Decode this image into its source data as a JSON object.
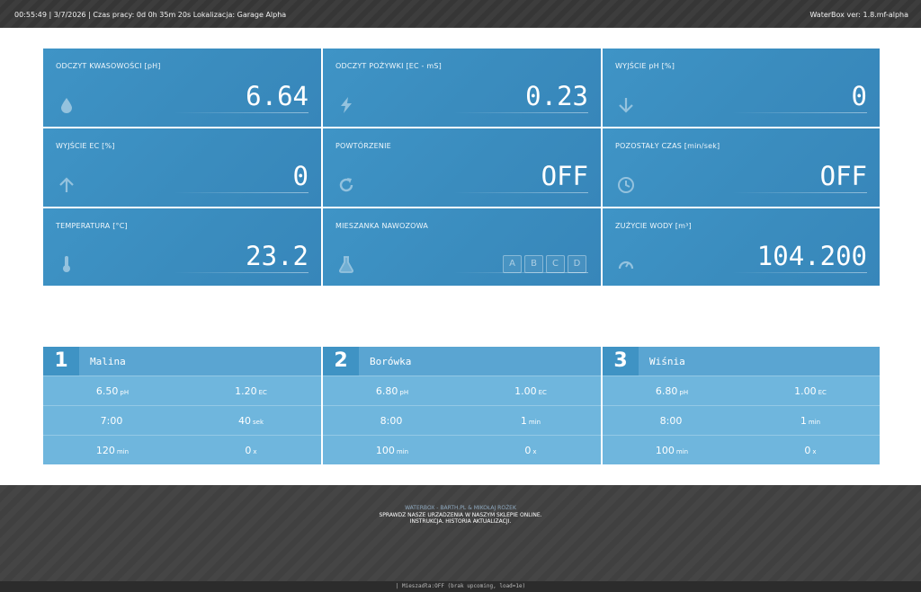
{
  "topbar": {
    "status_text": "00:55:49 | 3/7/2026 | Czas pracy: 0d 0h 35m 20s Lokalizacja: Garage Alpha",
    "version_text": "WaterBox ver: 1.8.mf-alpha"
  },
  "tiles": [
    {
      "label": "ODCZYT KWASOWOŚCI [pH]",
      "value": "6.64",
      "icon": "water-drop-icon"
    },
    {
      "label": "ODCZYT POŻYWKI [EC - mS]",
      "value": "0.23",
      "icon": "lightning-icon"
    },
    {
      "label": "WYJŚCIE pH [%]",
      "value": "0",
      "icon": "arrow-down-icon"
    },
    {
      "label": "WYJŚCIE EC [%]",
      "value": "0",
      "icon": "arrow-up-icon"
    },
    {
      "label": "POWTÓRZENIE",
      "value": "OFF",
      "icon": "refresh-icon"
    },
    {
      "label": "POZOSTAŁY CZAS [min/sek]",
      "value": "OFF",
      "icon": "clock-icon"
    },
    {
      "label": "TEMPERATURA [°C]",
      "value": "23.2",
      "icon": "thermometer-icon"
    },
    {
      "label": "MIESZANKA NAWOZOWA",
      "value": "",
      "icon": "flask-icon",
      "buttons": [
        "A",
        "B",
        "C",
        "D"
      ]
    },
    {
      "label": "ZUŻYCIE WODY [m³]",
      "value": "104.200",
      "icon": "gauge-icon"
    }
  ],
  "programs": [
    {
      "number": "1",
      "name": "Malina",
      "rows": [
        [
          {
            "v": "6.50",
            "u": "pH"
          },
          {
            "v": "1.20",
            "u": "EC"
          }
        ],
        [
          {
            "v": "7:00",
            "u": ""
          },
          {
            "v": "40",
            "u": "sek"
          }
        ],
        [
          {
            "v": "120",
            "u": "min"
          },
          {
            "v": "0",
            "u": "x"
          }
        ]
      ]
    },
    {
      "number": "2",
      "name": "Borówka",
      "rows": [
        [
          {
            "v": "6.80",
            "u": "pH"
          },
          {
            "v": "1.00",
            "u": "EC"
          }
        ],
        [
          {
            "v": "8:00",
            "u": ""
          },
          {
            "v": "1",
            "u": "min"
          }
        ],
        [
          {
            "v": "100",
            "u": "min"
          },
          {
            "v": "0",
            "u": "x"
          }
        ]
      ]
    },
    {
      "number": "3",
      "name": "Wiśnia",
      "rows": [
        [
          {
            "v": "6.80",
            "u": "pH"
          },
          {
            "v": "1.00",
            "u": "EC"
          }
        ],
        [
          {
            "v": "8:00",
            "u": ""
          },
          {
            "v": "1",
            "u": "min"
          }
        ],
        [
          {
            "v": "100",
            "u": "min"
          },
          {
            "v": "0",
            "u": "x"
          }
        ]
      ]
    }
  ],
  "footer": {
    "credits": "WATERBOX - BARTH.PL & MIKOŁAJ ROŻEK",
    "shop_text": "SPRAWDZ NASZE URZADZENIA W NASZYM SKLEPIE ONLINE.",
    "links_text": "INSTRUKCJA. HISTORIA AKTUALIZACJI."
  },
  "statusbar": {
    "text": "| Mieszadła:OFF (brak upcoming, load=1e)"
  }
}
